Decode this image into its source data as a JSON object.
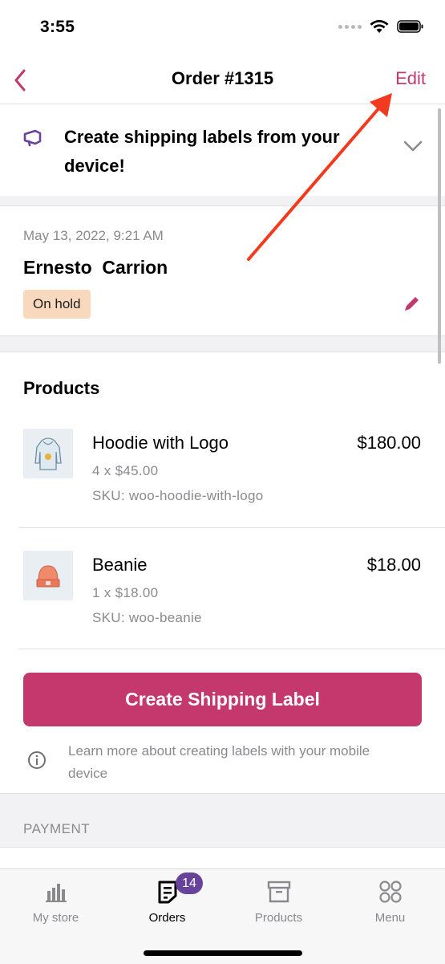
{
  "status_bar": {
    "time": "3:55"
  },
  "nav": {
    "title": "Order #1315",
    "edit_label": "Edit"
  },
  "banner": {
    "text": "Create shipping labels from your device!"
  },
  "order": {
    "date": "May 13, 2022, 9:21 AM",
    "customer": "Ernesto  Carrion",
    "status": "On hold"
  },
  "products": {
    "title": "Products",
    "items": [
      {
        "name": "Hoodie with Logo",
        "quantity": "4 x $45.00",
        "sku": "SKU: woo-hoodie-with-logo",
        "price": "$180.00"
      },
      {
        "name": "Beanie",
        "quantity": "1 x $18.00",
        "sku": "SKU: woo-beanie",
        "price": "$18.00"
      }
    ],
    "create_label_button": "Create Shipping Label",
    "learn_more": "Learn more about creating labels with your mobile device"
  },
  "payment": {
    "label": "PAYMENT"
  },
  "tabs": [
    {
      "label": "My store",
      "icon": "chart-icon",
      "active": false
    },
    {
      "label": "Orders",
      "icon": "orders-icon",
      "active": true,
      "badge": "14"
    },
    {
      "label": "Products",
      "icon": "archive-box-icon",
      "active": false
    },
    {
      "label": "Menu",
      "icon": "grid-circles-icon",
      "active": false
    }
  ],
  "colors": {
    "accent": "#c4386e",
    "status_on_hold_bg": "#f9d9be",
    "badge_purple": "#674399",
    "annotation_arrow": "#f23b1e"
  }
}
